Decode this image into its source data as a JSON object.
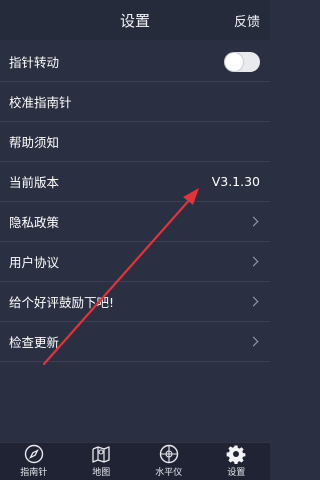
{
  "header": {
    "title": "设置",
    "feedback": "反馈"
  },
  "settings": [
    {
      "label": "指针转动",
      "control": "toggle",
      "toggle_on": false
    },
    {
      "label": "校准指南针"
    },
    {
      "label": "帮助须知"
    },
    {
      "label": "当前版本",
      "value": "V3.1.30"
    },
    {
      "label": "隐私政策",
      "chevron": true
    },
    {
      "label": "用户协议",
      "chevron": true
    },
    {
      "label": "给个好评鼓励下吧!",
      "chevron": true
    },
    {
      "label": "检查更新",
      "chevron": true
    }
  ],
  "tabs": [
    {
      "label": "指南针",
      "icon": "compass-icon"
    },
    {
      "label": "地图",
      "icon": "map-icon"
    },
    {
      "label": "水平仪",
      "icon": "level-icon"
    },
    {
      "label": "设置",
      "icon": "gear-icon"
    }
  ],
  "colors": {
    "background": "#2a2f42",
    "header": "#262b3c",
    "tabbar": "#1f2333",
    "annotation_arrow": "#e0333a"
  }
}
